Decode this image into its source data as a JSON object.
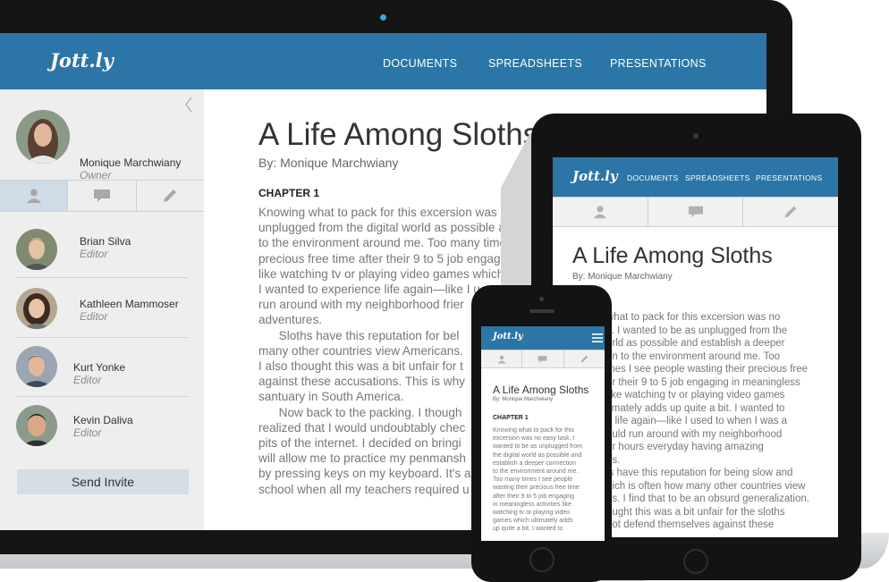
{
  "app": {
    "logo": "Jott.ly"
  },
  "nav": [
    "DOCUMENTS",
    "SPREADSHEETS",
    "PRESENTATIONS"
  ],
  "owner": {
    "name": "Monique Marchwiany",
    "role": "Owner"
  },
  "collaborators": [
    {
      "name": "Brian Silva",
      "role": "Editor"
    },
    {
      "name": "Kathleen Mammoser",
      "role": "Editor"
    },
    {
      "name": "Kurt Yonke",
      "role": "Editor"
    },
    {
      "name": "Kevin Daliva",
      "role": "Editor"
    }
  ],
  "sidebar": {
    "invite_label": "Send Invite"
  },
  "document": {
    "title": "A Life Among Sloths",
    "byline": "By: Monique Marchwiany",
    "chapter": "CHAPTER 1",
    "laptop_lines": [
      "Knowing what to pack for this excersion was no e",
      "unplugged from the digital world as possible and",
      "to the environment around me. Too many times I",
      "precious free time after their 9 to 5 job engaging i",
      "like watching tv or playing video games which ulti",
      "I wanted to experience life again—like I u",
      "run around with my neighborhood frier",
      "adventures.",
      "      Sloths have this reputation for bel",
      "many other countries view Americans.",
      "I also thought this was a bit unfair for t",
      "against these accusations. This is why",
      "santuary in South America.",
      "      Now back to the packing. I though",
      "realized that I would undoubtably chec",
      "pits of the internet. I decided on bringi",
      "will allow me to practice my penmansh",
      "by pressing keys on my keyboard. It's a",
      "school when all my teachers required u"
    ],
    "tablet_chapter": "1",
    "tablet_lines": [
      "what to pack for this excersion was no",
      "k. I wanted to be as unplugged from the",
      "orld as possible and establish a deeper",
      "on to the environment around me. Too",
      "mes I see people wasting their precious free",
      "er their 9 to 5 job engaging in meaningless",
      "like watching tv or playing video games",
      "timately adds up quite a bit. I wanted to",
      "e life again—like I used to when I was a",
      "ould run around with my neighborhood",
      "or hours everyday having amazing",
      "es.",
      "is have this reputation for being slow and",
      "hich is often how many other countries view",
      "ns. I find that to be an obsurd generalization.",
      "ought this was a bit unfair for the sloths",
      "not defend themselves against these"
    ],
    "phone_lines": [
      "Knowing what to pack for this",
      "excersion was no easy task. I",
      "wanted to be as unplugged from",
      "the digital world as possible and",
      "establish a deeper connection",
      "to the environment around me.",
      "Too many times I see people",
      "wasting their precious free time",
      "after their 9 to 5 job engaging",
      "in meaningless activities like",
      "watching tv or playing video",
      "games which ultimately adds",
      "up quite a bit. I wanted to"
    ]
  },
  "icons": {
    "tab_people": "person-icon",
    "tab_comments": "speech-bubble-icon",
    "tab_edit": "pencil-icon",
    "collapse": "chevron-left-icon",
    "menu": "hamburger-menu-icon"
  },
  "colors": {
    "brand_blue": "#2b76a6",
    "sidebar_bg": "#eeeeee",
    "active_tab": "#cfdce8",
    "invite_button": "#d5dde5",
    "device_frame": "#141414"
  }
}
